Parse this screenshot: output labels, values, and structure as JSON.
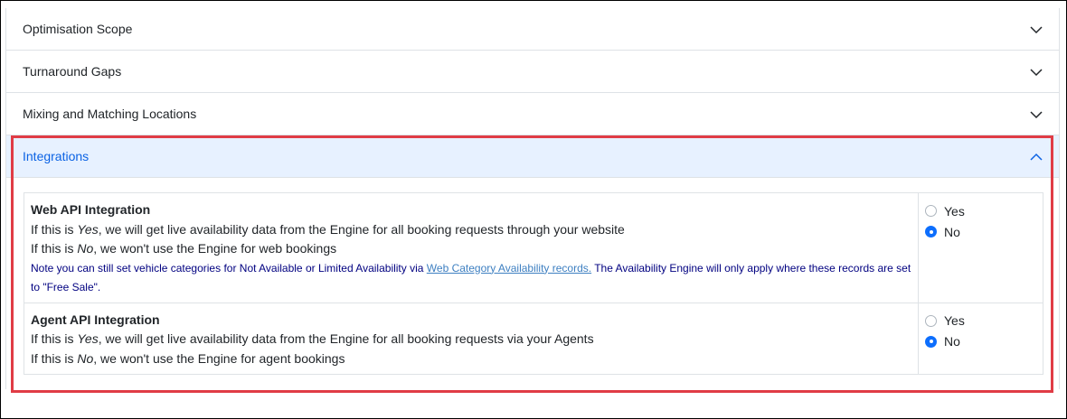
{
  "accordion": {
    "sections": [
      {
        "title": "Optimisation Scope"
      },
      {
        "title": "Turnaround Gaps"
      },
      {
        "title": "Mixing and Matching Locations"
      },
      {
        "title": "Integrations"
      }
    ]
  },
  "integrations": {
    "web": {
      "title": "Web API Integration",
      "yes_prefix": "If this is ",
      "yes_word": "Yes",
      "yes_suffix": ", we will get live availability data from the Engine for all booking requests through your website",
      "no_prefix": "If this is ",
      "no_word": "No",
      "no_suffix": ", we won't use the Engine for web bookings",
      "note_before": "Note you can still set vehicle categories for Not Available or Limited Availability via ",
      "note_link": "Web Category Availability records.",
      "note_after": " The Availability Engine will only apply where these records are set to \"Free Sale\".",
      "option_yes": "Yes",
      "option_no": "No",
      "selected": "No"
    },
    "agent": {
      "title": "Agent API Integration",
      "yes_prefix": "If this is ",
      "yes_word": "Yes",
      "yes_suffix": ", we will get live availability data from the Engine for all booking requests via your Agents",
      "no_prefix": "If this is ",
      "no_word": "No",
      "no_suffix": ", we won't use the Engine for agent bookings",
      "option_yes": "Yes",
      "option_no": "No",
      "selected": "No"
    }
  },
  "colors": {
    "highlight_border": "#e03c45",
    "open_header_bg": "#e7f1ff",
    "open_header_text": "#0c63e4",
    "radio_checked": "#0d6efd",
    "note_text": "#000080"
  }
}
